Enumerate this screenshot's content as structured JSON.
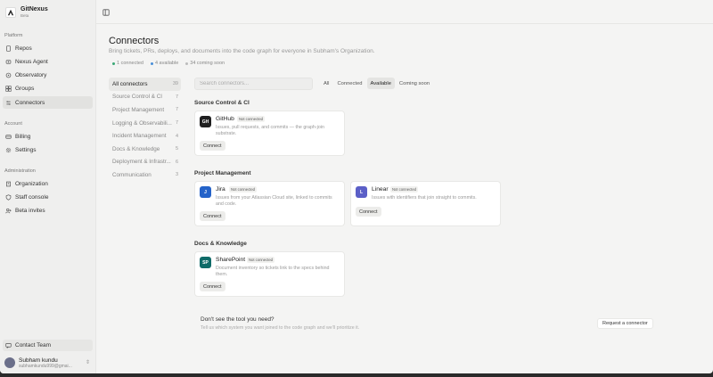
{
  "brand": {
    "name": "GitNexus",
    "sub": "Beta"
  },
  "sidebar": {
    "sections": [
      {
        "label": "Platform",
        "items": [
          {
            "label": "Repos",
            "icon": "repo-icon"
          },
          {
            "label": "Nexus Agent",
            "icon": "agent-icon"
          },
          {
            "label": "Observatory",
            "icon": "observatory-icon"
          },
          {
            "label": "Groups",
            "icon": "groups-icon"
          },
          {
            "label": "Connectors",
            "icon": "connectors-icon",
            "active": true
          }
        ]
      },
      {
        "label": "Account",
        "items": [
          {
            "label": "Billing",
            "icon": "billing-icon"
          },
          {
            "label": "Settings",
            "icon": "settings-icon"
          }
        ]
      },
      {
        "label": "Administration",
        "items": [
          {
            "label": "Organization",
            "icon": "organization-icon"
          },
          {
            "label": "Staff console",
            "icon": "staff-icon"
          },
          {
            "label": "Beta invites",
            "icon": "invites-icon"
          }
        ]
      }
    ],
    "contact_label": "Contact Team",
    "user": {
      "name": "Subham kundu",
      "email": "subhamkundu999@gmai..."
    }
  },
  "header": {
    "title": "Connectors",
    "subtitle": "Bring tickets, PRs, deploys, and documents into the code graph for everyone in Subham's Organization.",
    "stats": [
      {
        "label": "1 connected",
        "color": "#3aa776"
      },
      {
        "label": "4 available",
        "color": "#4a8fd8"
      },
      {
        "label": "34 coming soon",
        "color": "#bbbbbb"
      }
    ]
  },
  "categories": [
    {
      "label": "All connectors",
      "count": "39",
      "active": true
    },
    {
      "label": "Source Control & CI",
      "count": "7"
    },
    {
      "label": "Project Management",
      "count": "7"
    },
    {
      "label": "Logging & Observabili...",
      "count": "7"
    },
    {
      "label": "Incident Management",
      "count": "4"
    },
    {
      "label": "Docs & Knowledge",
      "count": "5"
    },
    {
      "label": "Deployment & Infrastr...",
      "count": "6"
    },
    {
      "label": "Communication",
      "count": "3"
    }
  ],
  "search": {
    "placeholder": "Search connectors..."
  },
  "filters": [
    {
      "label": "All"
    },
    {
      "label": "Connected"
    },
    {
      "label": "Available",
      "active": true
    },
    {
      "label": "Coming soon"
    }
  ],
  "groups": [
    {
      "title": "Source Control & CI",
      "cards": [
        {
          "name": "GitHub",
          "badge": "Not connected",
          "desc": "Issues, pull requests, and commits — the graph-join substrate.",
          "button": "Connect",
          "logo_text": "GH",
          "logo_color": "#1f1f1f"
        }
      ]
    },
    {
      "title": "Project Management",
      "cards": [
        {
          "name": "Jira",
          "badge": "Not connected",
          "desc": "Issues from your Atlassian Cloud site, linked to commits and code.",
          "button": "Connect",
          "logo_text": "J",
          "logo_color": "#2563c9"
        },
        {
          "name": "Linear",
          "badge": "Not connected",
          "desc": "Issues with identifiers that join straight to commits.",
          "button": "Connect",
          "logo_text": "L",
          "logo_color": "#5b5fc7"
        }
      ]
    },
    {
      "title": "Docs & Knowledge",
      "cards": [
        {
          "name": "SharePoint",
          "badge": "Not connected",
          "desc": "Document inventory so tickets link to the specs behind them.",
          "button": "Connect",
          "logo_text": "SP",
          "logo_color": "#0f6b68"
        }
      ]
    }
  ],
  "prompt": {
    "title": "Don't see the tool you need?",
    "sub": "Tell us which system you want joined to the code graph and we'll prioritize it.",
    "button": "Request a connector"
  }
}
